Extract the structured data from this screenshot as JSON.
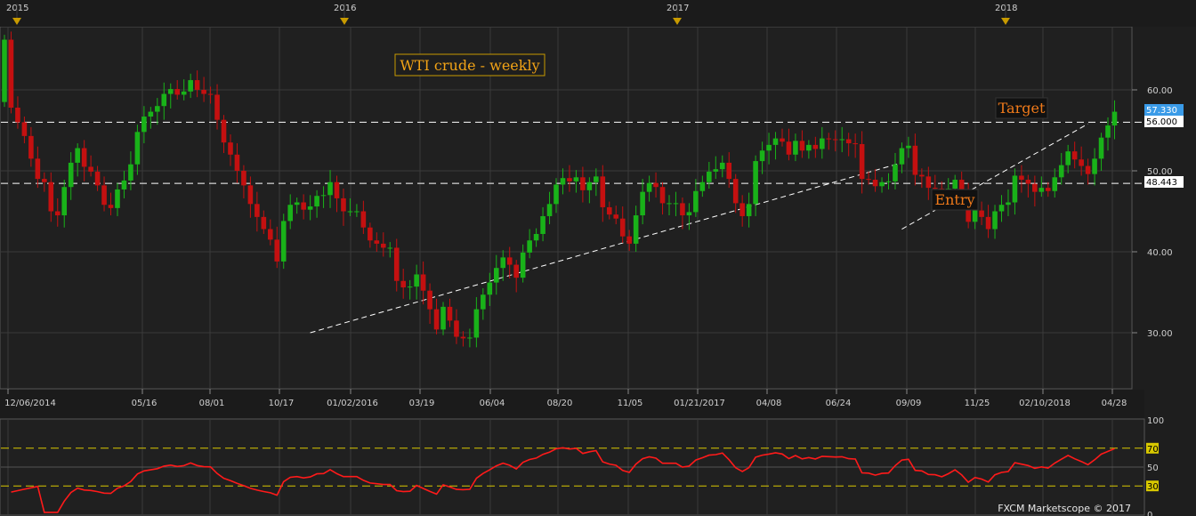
{
  "colors": {
    "background": "#1e1e1e",
    "plot_bg": "#202020",
    "grid": "#3a3a3a",
    "bull": "#19b219",
    "bear": "#c41010",
    "rsi_line": "#ff1a1a",
    "level_line": "#ffffff",
    "rsi_level": "#d8c800",
    "marker": "#c79a00",
    "title_border": "#c79a00",
    "title_text": "#f2a316",
    "price_tag": "#3a9be8"
  },
  "header": {
    "year_labels": [
      "2015",
      "2016",
      "2017",
      "2018"
    ]
  },
  "chart_title": "WTI crude - weekly",
  "annotations": {
    "target_label": "Target",
    "entry_label": "Entry"
  },
  "price_axis": {
    "ticks": [
      "60.00",
      "50.00",
      "40.00",
      "30.00"
    ],
    "tag_last": "57.330",
    "tag_target": "56.000",
    "tag_entry": "48.443"
  },
  "date_axis": {
    "ticks": [
      "12/06/2014",
      "05/16",
      "08/01",
      "10/17",
      "01/02/2016",
      "03/19",
      "06/04",
      "08/20",
      "11/05",
      "01/21/2017",
      "04/08",
      "06/24",
      "09/09",
      "11/25",
      "02/10/2018",
      "04/28"
    ]
  },
  "rsi_axis": {
    "ticks": [
      "100",
      "70",
      "50",
      "30",
      "0"
    ]
  },
  "copyright": "FXCM Marketscope © 2017",
  "chart_data": {
    "type": "candlestick",
    "title": "WTI crude - weekly",
    "xlabel": "",
    "ylabel": "",
    "ylim": [
      24,
      67
    ],
    "levels": [
      {
        "name": "Target",
        "value": 56.0
      },
      {
        "name": "Entry",
        "value": 48.443
      }
    ],
    "last_price": 57.33,
    "trendlines": [
      {
        "from": [
          "2015-10-12",
          30.0
        ],
        "to": [
          "2017-06-26",
          51.0
        ]
      },
      {
        "from": [
          "2017-06-26",
          42.8
        ],
        "to": [
          "2018-01-08",
          55.8
        ]
      }
    ],
    "start_date": "2014-11-24",
    "interval": "weekly",
    "closes": [
      66.2,
      57.8,
      56.0,
      54.3,
      51.5,
      49.0,
      48.6,
      45.0,
      44.5,
      48.0,
      51.0,
      52.8,
      50.5,
      49.9,
      48.2,
      45.8,
      45.4,
      47.7,
      48.8,
      50.8,
      54.8,
      56.7,
      57.3,
      58.0,
      59.5,
      60.1,
      59.4,
      59.8,
      61.2,
      60.0,
      59.5,
      59.4,
      56.3,
      53.5,
      52.0,
      50.0,
      48.2,
      45.9,
      44.3,
      42.8,
      41.5,
      38.8,
      43.8,
      45.8,
      46.1,
      45.2,
      45.6,
      46.9,
      47.0,
      48.6,
      46.6,
      45.0,
      45.0,
      45.0,
      43.0,
      41.4,
      41.0,
      40.5,
      40.5,
      36.4,
      35.6,
      35.7,
      37.2,
      35.2,
      32.9,
      30.4,
      33.2,
      31.5,
      29.5,
      29.3,
      29.4,
      32.9,
      34.7,
      36.2,
      38.0,
      39.3,
      38.4,
      36.8,
      39.9,
      41.4,
      42.2,
      44.4,
      45.9,
      48.3,
      49.1,
      48.7,
      49.2,
      47.6,
      48.6,
      49.3,
      45.5,
      44.6,
      44.1,
      41.9,
      41.0,
      44.5,
      47.4,
      48.5,
      48.0,
      46.0,
      46.0,
      46.0,
      44.5,
      44.9,
      47.5,
      48.6,
      49.9,
      50.2,
      51.0,
      49.0,
      46.0,
      44.4,
      45.9,
      51.2,
      52.5,
      53.2,
      54.0,
      53.6,
      52.0,
      53.7,
      52.5,
      53.2,
      52.7,
      54.0,
      53.9,
      53.8,
      53.9,
      53.4,
      53.3,
      49.0,
      48.9,
      48.1,
      48.6,
      48.7,
      50.8,
      52.8,
      53.1,
      49.5,
      49.3,
      47.9,
      47.8,
      47.0,
      47.8,
      48.9,
      47.1,
      43.7,
      45.1,
      44.3,
      42.8,
      45.0,
      45.8,
      46.1,
      49.4,
      48.9,
      48.4,
      47.4,
      47.9,
      47.5,
      49.2,
      50.7,
      52.4,
      51.4,
      50.6,
      49.6,
      51.5,
      54.1,
      55.6,
      57.3
    ]
  }
}
